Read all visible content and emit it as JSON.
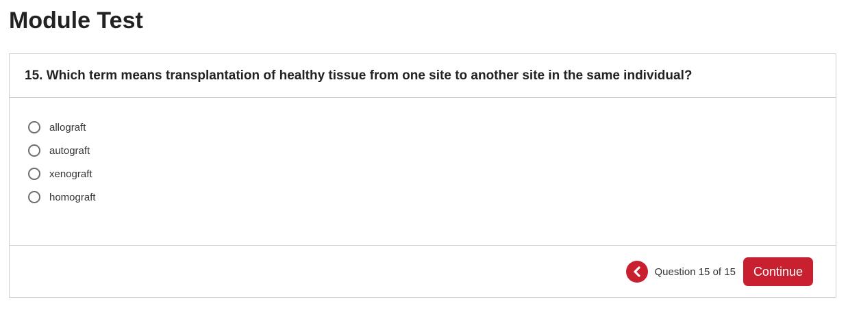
{
  "page": {
    "title": "Module Test"
  },
  "question": {
    "text": "15. Which term means transplantation of healthy tissue from one site to another site in the same individual?",
    "options": [
      {
        "label": "allograft",
        "selected": false
      },
      {
        "label": "autograft",
        "selected": false
      },
      {
        "label": "xenograft",
        "selected": false
      },
      {
        "label": "homograft",
        "selected": false
      }
    ]
  },
  "footer": {
    "back_icon": "chevron-left-icon",
    "counter": "Question 15 of 15",
    "continue_label": "Continue"
  },
  "colors": {
    "accent": "#c8202f",
    "border": "#cfcfcf"
  }
}
